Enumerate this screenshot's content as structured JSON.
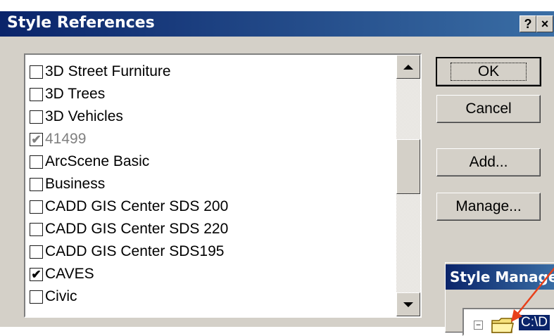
{
  "dialog": {
    "title": "Style References",
    "help_label": "?",
    "close_label": "×"
  },
  "styles": [
    {
      "label": "3D Street Furniture",
      "checked": false,
      "disabled": false
    },
    {
      "label": "3D Trees",
      "checked": false,
      "disabled": false
    },
    {
      "label": "3D Vehicles",
      "checked": false,
      "disabled": false
    },
    {
      "label": "41499",
      "checked": true,
      "disabled": true
    },
    {
      "label": "ArcScene Basic",
      "checked": false,
      "disabled": false
    },
    {
      "label": "Business",
      "checked": false,
      "disabled": false
    },
    {
      "label": "CADD GIS Center SDS 200",
      "checked": false,
      "disabled": false
    },
    {
      "label": "CADD GIS Center SDS 220",
      "checked": false,
      "disabled": false
    },
    {
      "label": "CADD GIS Center SDS195",
      "checked": false,
      "disabled": false
    },
    {
      "label": "CAVES",
      "checked": true,
      "disabled": false
    },
    {
      "label": "Civic",
      "checked": false,
      "disabled": false
    }
  ],
  "buttons": {
    "ok": "OK",
    "cancel": "Cancel",
    "add": "Add...",
    "manage": "Manage..."
  },
  "style_manager": {
    "title": "Style Manage",
    "expander": "−",
    "path": "C:\\D"
  },
  "icons": {
    "help": "help-icon",
    "close": "close-icon",
    "scroll_up": "scroll-up-arrow-icon",
    "scroll_down": "scroll-down-arrow-icon",
    "folder": "folder-icon",
    "checkmark": "checkmark-icon"
  },
  "colors": {
    "titlebar_start": "#0a246a",
    "titlebar_end": "#3a6ea5",
    "dialog_bg": "#d4d0c8",
    "arrow": "#e8401a"
  }
}
